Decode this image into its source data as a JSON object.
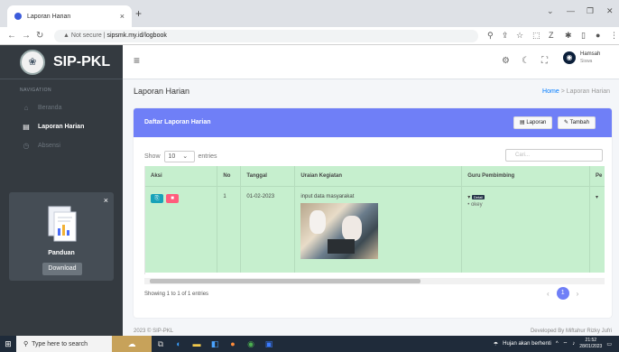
{
  "browser": {
    "tab_title": "Laporan Harian",
    "tab_close": "×",
    "new_tab": "+",
    "not_secure": "Not secure",
    "url": "sipsmk.my.id/logbook"
  },
  "sidebar": {
    "brand": "SIP-PKL",
    "nav_header": "NAVIGATION",
    "items": [
      {
        "label": "Beranda",
        "icon": "home-icon"
      },
      {
        "label": "Laporan Harian",
        "icon": "book-icon"
      },
      {
        "label": "Absensi",
        "icon": "clock-icon"
      }
    ],
    "panduan": {
      "title": "Panduan",
      "button": "Download",
      "close": "×"
    }
  },
  "topbar": {
    "user_name": "Hamsah",
    "user_role": "Siswa"
  },
  "page": {
    "title": "Laporan Harian",
    "breadcrumb_home": "Home",
    "breadcrumb_sep": ">",
    "breadcrumb_current": "Laporan Harian"
  },
  "card": {
    "title": "Daftar Laporan Harian",
    "btn_laporan": "Laporan",
    "btn_tambah": "Tambah",
    "show_label": "Show",
    "show_value": "10",
    "entries_label": "entries",
    "search_placeholder": "Cari...",
    "columns": [
      "Aksi",
      "No",
      "Tanggal",
      "Uraian Kegiatan",
      "Guru Pembimbing",
      "Pe"
    ],
    "rows": [
      {
        "no": "1",
        "tanggal": "01-02-2023",
        "uraian": "input data masyarakat",
        "guru_badge": "Detail",
        "guru_note": "okey"
      }
    ],
    "showing": "Showing 1 to 1 of 1 entries",
    "page_prev": "‹",
    "page_current": "1",
    "page_next": "›"
  },
  "footer": {
    "left": "2023 © SIP-PKL",
    "right": "Developed By Miftahur Rizky Jufri"
  },
  "taskbar": {
    "search_placeholder": "Type here to search",
    "weather": "Hujan akan berhenti",
    "time": "21:52",
    "date": "28/01/2023"
  },
  "colors": {
    "sidebar_bg": "#343a40",
    "card_header": "#6f7ff7",
    "table_row": "#c6efce",
    "btn_edit": "#17a2b8",
    "btn_delete": "#ff5c7c"
  }
}
